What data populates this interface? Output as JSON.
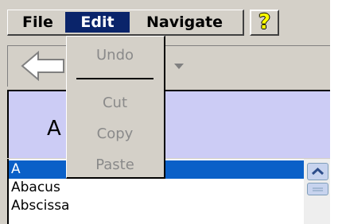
{
  "menubar": {
    "file": "File",
    "edit": "Edit",
    "navigate": "Navigate",
    "help_icon": "?"
  },
  "toolbar": {
    "back_icon": "back-arrow-icon",
    "dropdown_icon": "dropdown-arrow-icon"
  },
  "header": {
    "letter": "A"
  },
  "edit_menu": {
    "undo": "Undo",
    "cut": "Cut",
    "copy": "Copy",
    "paste": "Paste"
  },
  "list": {
    "items": [
      "A",
      "Abacus",
      "Abscissa"
    ],
    "selected_index": 0
  },
  "colors": {
    "menu_highlight": "#0a246a",
    "list_selection": "#0a60c8",
    "header_bg": "#ccccf5",
    "chrome": "#d4d0c8",
    "disabled_text": "#8a8a8a"
  }
}
